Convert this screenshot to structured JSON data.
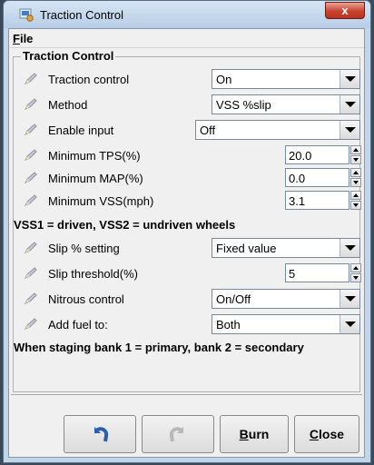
{
  "window": {
    "title": "Traction Control",
    "close_glyph": "x"
  },
  "menu": {
    "file_label": "File",
    "file_mnemonic": "F",
    "file_rest": "ile"
  },
  "group": {
    "title": "Traction Control"
  },
  "rows": {
    "traction_control": {
      "label": "Traction control",
      "value": "On"
    },
    "method": {
      "label": "Method",
      "value": "VSS %slip"
    },
    "enable_input": {
      "label": "Enable input",
      "value": "Off"
    },
    "min_tps": {
      "label": "Minimum TPS(%)",
      "value": "20.0"
    },
    "min_map": {
      "label": "Minimum MAP(%)",
      "value": "0.0"
    },
    "min_vss": {
      "label": "Minimum VSS(mph)",
      "value": "3.1"
    },
    "slip_setting": {
      "label": "Slip % setting",
      "value": "Fixed value"
    },
    "slip_threshold": {
      "label": "Slip threshold(%)",
      "value": "5"
    },
    "nitrous_control": {
      "label": "Nitrous control",
      "value": "On/Off"
    },
    "add_fuel": {
      "label": "Add fuel to:",
      "value": "Both"
    }
  },
  "notes": {
    "vss": "VSS1 = driven, VSS2 = undriven wheels",
    "staging": "When staging bank 1 = primary, bank 2 = secondary"
  },
  "buttons": {
    "undo_icon": "undo-icon",
    "redo_icon": "redo-icon",
    "burn_mnemonic": "B",
    "burn_rest": "urn",
    "close_mnemonic": "C",
    "close_rest": "lose"
  }
}
